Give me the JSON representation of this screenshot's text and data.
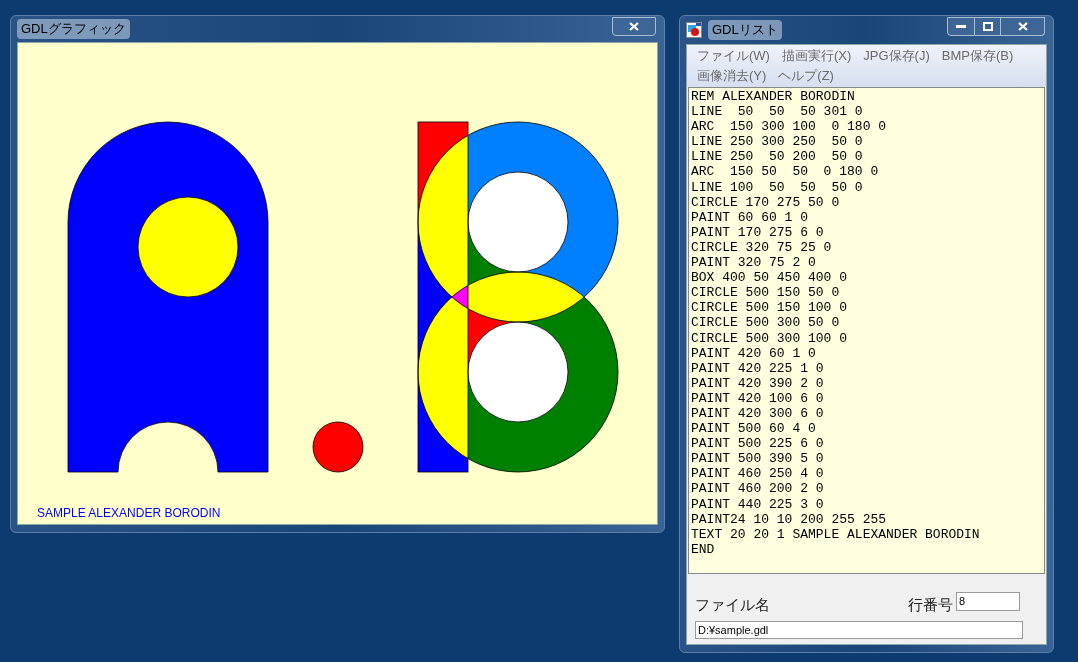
{
  "graphics_window": {
    "title": "GDLグラフィック",
    "caption": "SAMPLE ALEXANDER BORODIN"
  },
  "list_window": {
    "title": "GDLリスト",
    "menu": [
      "ファイル(W)",
      "描画実行(X)",
      "JPG保存(J)",
      "BMP保存(B)",
      "画像消去(Y)",
      "ヘルプ(Z)"
    ],
    "listing": [
      "REM ALEXANDER BORODIN",
      "LINE  50  50  50 301 0",
      "ARC  150 300 100  0 180 0",
      "LINE 250 300 250  50 0",
      "LINE 250  50 200  50 0",
      "ARC  150 50  50  0 180 0",
      "LINE 100  50  50  50 0",
      "CIRCLE 170 275 50 0",
      "PAINT 60 60 1 0",
      "PAINT 170 275 6 0",
      "CIRCLE 320 75 25 0",
      "PAINT 320 75 2 0",
      "BOX 400 50 450 400 0",
      "CIRCLE 500 150 50 0",
      "CIRCLE 500 150 100 0",
      "CIRCLE 500 300 50 0",
      "CIRCLE 500 300 100 0",
      "PAINT 420 60 1 0",
      "PAINT 420 225 1 0",
      "PAINT 420 390 2 0",
      "PAINT 420 100 6 0",
      "PAINT 420 300 6 0",
      "PAINT 500 60 4 0",
      "PAINT 500 225 6 0",
      "PAINT 500 390 5 0",
      "PAINT 460 250 4 0",
      "PAINT 460 200 2 0",
      "PAINT 440 225 3 0",
      "PAINT24 10 10 200 255 255",
      "TEXT 20 20 1 SAMPLE ALEXANDER BORODIN",
      "END"
    ],
    "file_label": "ファイル名",
    "line_label": "行番号",
    "line_number": "8",
    "file_path": "D:¥sample.gdl"
  }
}
